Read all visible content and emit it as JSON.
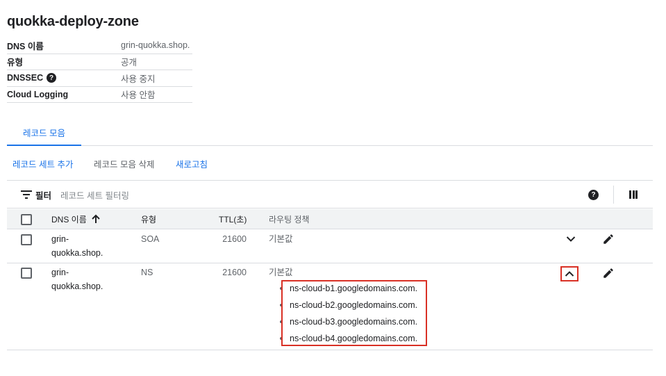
{
  "zone": {
    "title": "quokka-deploy-zone"
  },
  "properties": [
    {
      "key": "DNS 이름",
      "value": "grin-quokka.shop."
    },
    {
      "key": "유형",
      "value": "공개"
    },
    {
      "key": "DNSSEC",
      "value": "사용 중지",
      "has_help": true
    },
    {
      "key": "Cloud Logging",
      "value": "사용 안함"
    }
  ],
  "tabs": [
    {
      "label": "레코드 모음",
      "active": true
    }
  ],
  "actions": {
    "add": "레코드 세트 추가",
    "delete": "레코드 모음 삭제",
    "refresh": "새로고침"
  },
  "filter": {
    "label": "필터",
    "placeholder": "레코드 세트 필터링",
    "help_icon": "help-circle-icon",
    "columns_icon": "column-display-icon"
  },
  "table": {
    "headers": {
      "name": "DNS 이름",
      "type": "유형",
      "ttl": "TTL(초)",
      "routing": "라우팅 정책"
    },
    "sort_icon": "arrow-up-icon",
    "rows": [
      {
        "name_line1": "grin-",
        "name_line2": "quokka.shop.",
        "type": "SOA",
        "ttl": "21600",
        "routing": "기본값",
        "expanded": false
      },
      {
        "name_line1": "grin-",
        "name_line2": "quokka.shop.",
        "type": "NS",
        "ttl": "21600",
        "routing": "기본값",
        "expanded": true,
        "values": [
          "ns-cloud-b1.googledomains.com.",
          "ns-cloud-b2.googledomains.com.",
          "ns-cloud-b3.googledomains.com.",
          "ns-cloud-b4.googledomains.com."
        ]
      }
    ]
  },
  "colors": {
    "accent": "#1a73e8",
    "highlight": "#d93025",
    "divider": "#dadce0"
  }
}
